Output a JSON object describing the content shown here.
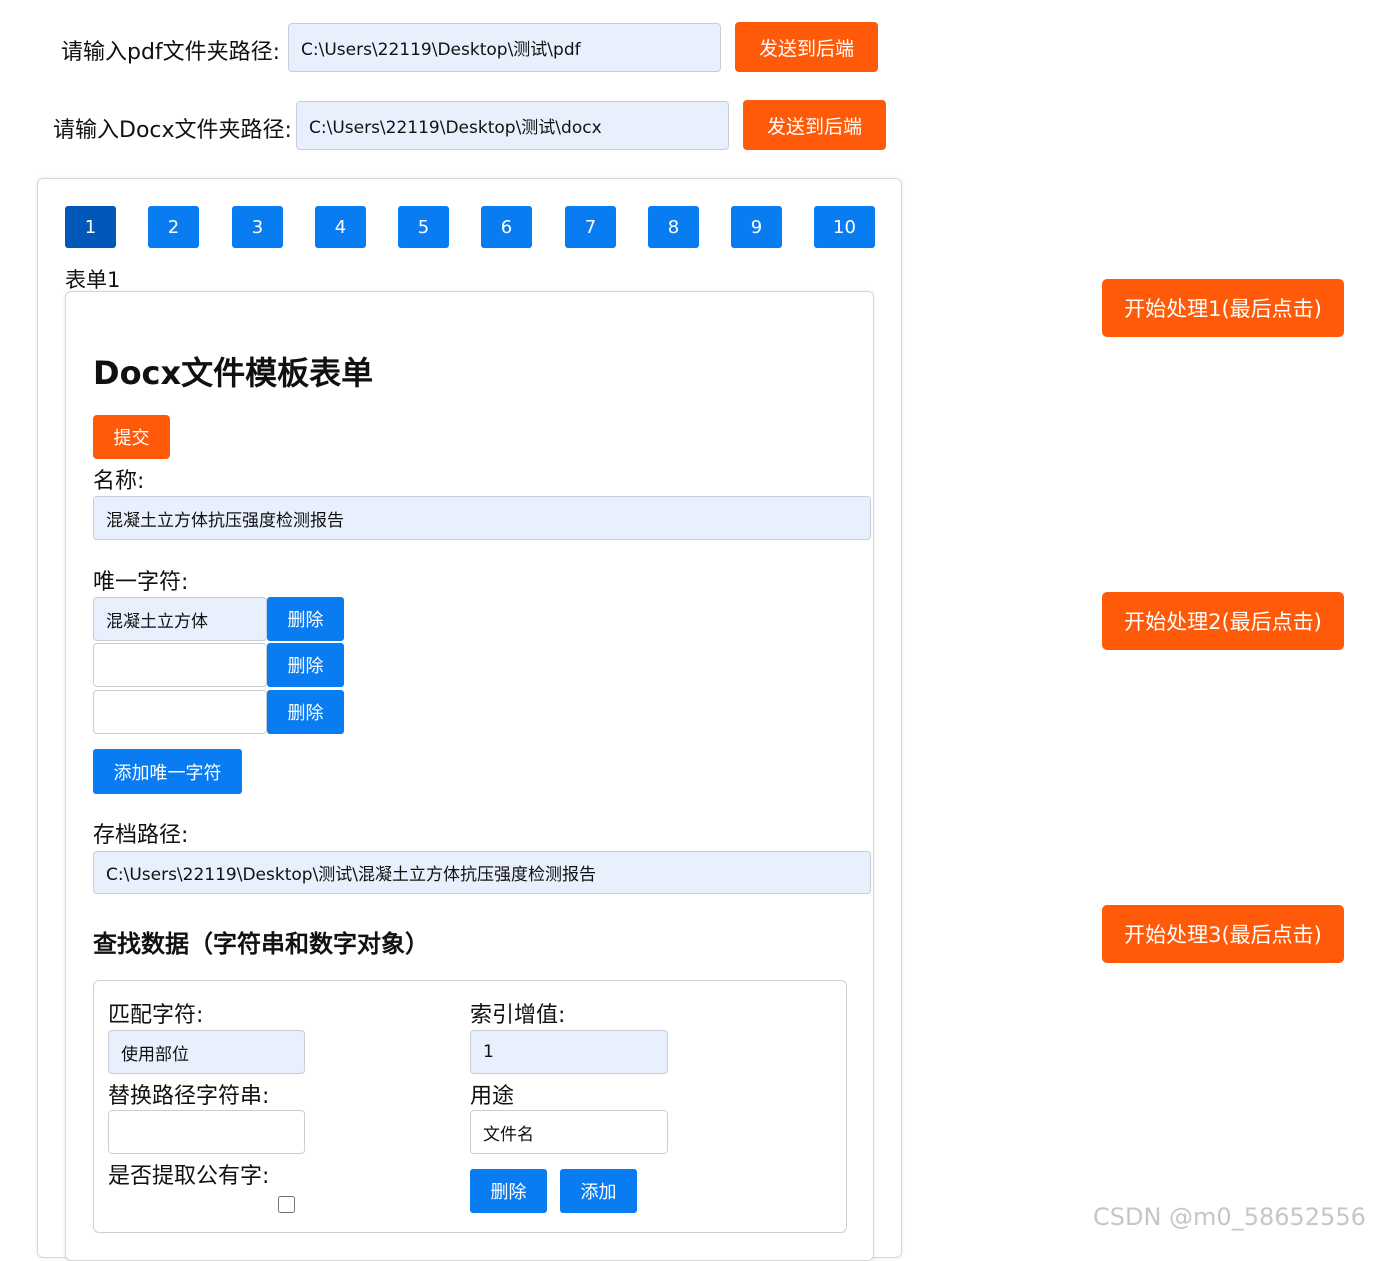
{
  "top": {
    "pdf_label": "请输入pdf文件夹路径:",
    "pdf_value": "C:\\Users\\22119\\Desktop\\测试\\pdf",
    "pdf_send": "发送到后端",
    "docx_label": "请输入Docx文件夹路径:",
    "docx_value": "C:\\Users\\22119\\Desktop\\测试\\docx",
    "docx_send": "发送到后端"
  },
  "pagination": {
    "pages": [
      "1",
      "2",
      "3",
      "4",
      "5",
      "6",
      "7",
      "8",
      "9",
      "10"
    ],
    "active": "1"
  },
  "form": {
    "tab_label": "表单1",
    "title": "Docx文件模板表单",
    "submit": "提交",
    "name_label": "名称:",
    "name_value": "混凝土立方体抗压强度检测报告",
    "unique_label": "唯一字符:",
    "unique_items": [
      "混凝土立方体",
      "",
      ""
    ],
    "delete_label": "删除",
    "add_unique": "添加唯一字符",
    "archive_label": "存档路径:",
    "archive_value": "C:\\Users\\22119\\Desktop\\测试\\混凝土立方体抗压强度检测报告",
    "search_title": "查找数据（字符串和数字对象）",
    "search": {
      "match_label": "匹配字符:",
      "match_value": "使用部位",
      "index_label": "索引增值:",
      "index_value": "1",
      "replace_label": "替换路径字符串:",
      "replace_value": "",
      "purpose_label": "用途",
      "purpose_value": "文件名",
      "extract_label": "是否提取公有字:",
      "extract_checked": false,
      "delete": "删除",
      "add": "添加"
    }
  },
  "side": {
    "start1": "开始处理1(最后点击)",
    "start2": "开始处理2(最后点击)",
    "start3": "开始处理3(最后点击)"
  },
  "watermark": "CSDN @m0_58652556",
  "colors": {
    "orange": "#ff5a0a",
    "blue": "#0a7cf2",
    "blue_active": "#0258b8",
    "input_bg": "#e8f0fe"
  }
}
